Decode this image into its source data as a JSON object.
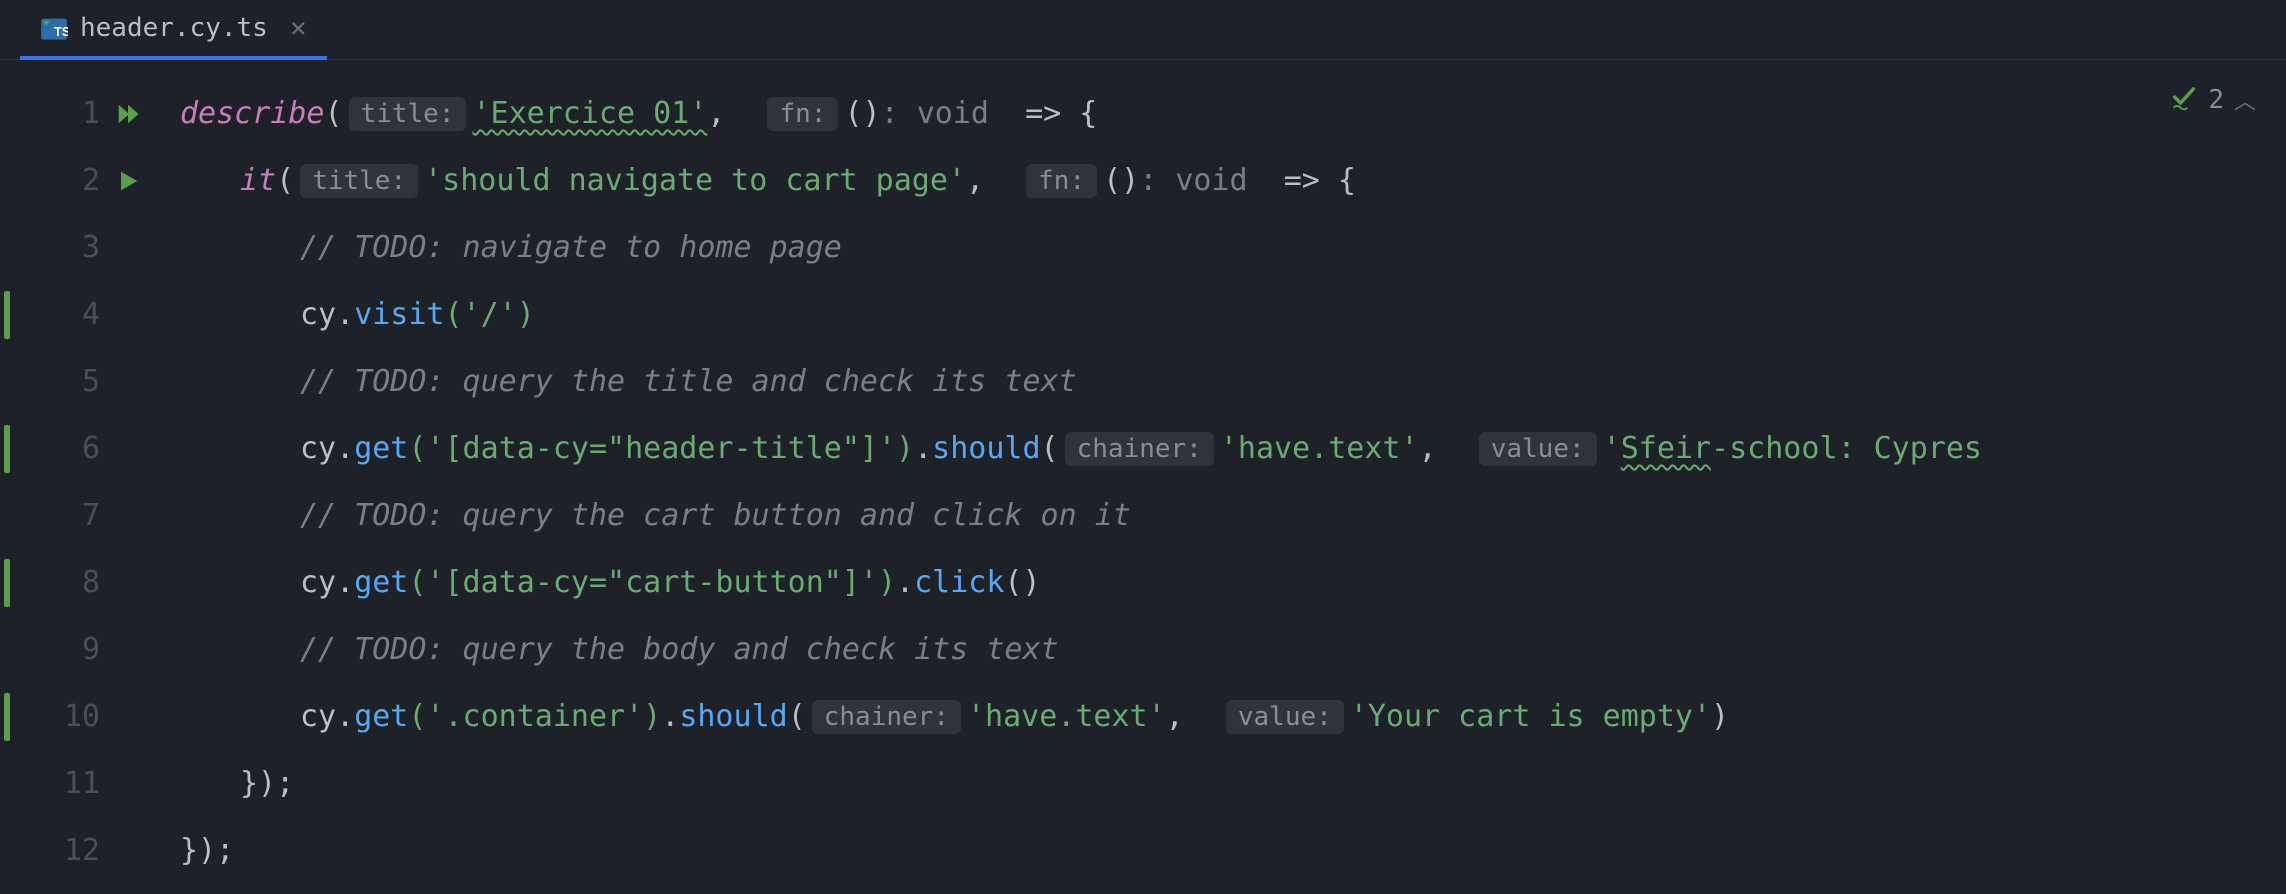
{
  "tab": {
    "filename": "header.cy.ts",
    "close_glyph": "×"
  },
  "problems": {
    "count": "2"
  },
  "gutter": {
    "lines": [
      "1",
      "2",
      "3",
      "4",
      "5",
      "6",
      "7",
      "8",
      "9",
      "10",
      "11",
      "12"
    ]
  },
  "hints": {
    "title": "title:",
    "fn": "fn:",
    "chainer": "chainer:",
    "value": "value:"
  },
  "code": {
    "l1": {
      "describe": "describe",
      "open": "(",
      "str": "'Exercice 01'",
      "comma": ",",
      "paren": "()",
      "void": ": void",
      "arrow": "  => {"
    },
    "l2": {
      "it": "it",
      "open": "(",
      "str": "'should navigate to cart page'",
      "comma": ",",
      "paren": "()",
      "void": ": void",
      "arrow": "  => {"
    },
    "l3": {
      "comment": "// TODO: navigate to home page"
    },
    "l4": {
      "cy": "cy",
      "dot": ".",
      "method": "visit",
      "args": "('/')"
    },
    "l5": {
      "comment": "// TODO: query the title and check its text"
    },
    "l6": {
      "cy": "cy",
      "dot1": ".",
      "get": "get",
      "sel": "('[data-cy=\"header-title\"]')",
      "dot2": ".",
      "should": "should",
      "open": "(",
      "chainer_val": "'have.text'",
      "comma": ",",
      "value_val_pre": "'",
      "value_val_u": "Sfeir",
      "value_val_post": "-school: Cypres"
    },
    "l7": {
      "comment": "// TODO: query the cart button and click on it"
    },
    "l8": {
      "cy": "cy",
      "dot1": ".",
      "get": "get",
      "sel": "('[data-cy=\"cart-button\"]')",
      "dot2": ".",
      "click": "click",
      "paren": "()"
    },
    "l9": {
      "comment": "// TODO: query the body and check its text"
    },
    "l10": {
      "cy": "cy",
      "dot1": ".",
      "get": "get",
      "sel": "('.container')",
      "dot2": ".",
      "should": "should",
      "open": "(",
      "chainer_val": "'have.text'",
      "comma": ",",
      "value_val": "'Your cart is empty'",
      "close": ")"
    },
    "l11": {
      "text": "});"
    },
    "l12": {
      "text": "});"
    }
  }
}
